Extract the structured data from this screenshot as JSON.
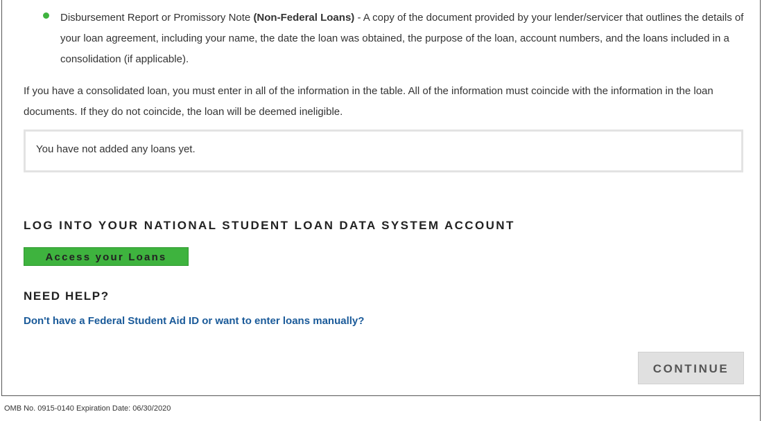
{
  "bullets": [
    {
      "lead": "Disbursement Report or Promissory Note",
      "bold": "(Non-Federal Loans)",
      "rest": "- A copy of the document provided by your lender/servicer that outlines the details of your loan agreement, including your name, the date the loan was obtained, the purpose of the loan, account numbers, and the loans included in a consolidation (if applicable).",
      "marker_color": "#3eb33e"
    }
  ],
  "info_text": "If you have a consolidated loan, you must enter in all of the information in the table. All of the information must coincide with the information in the loan documents. If they do not coincide, the loan will be deemed ineligible.",
  "loans_table": {
    "empty_message": "You have not added any loans yet."
  },
  "nslds": {
    "heading": "LOG INTO YOUR NATIONAL STUDENT LOAN DATA SYSTEM ACCOUNT",
    "button_label": "Access your Loans",
    "button_color": "#3eb33e"
  },
  "help": {
    "heading": "NEED HELP?",
    "link_text": "Don't have a Federal Student Aid ID or want to enter loans manually?",
    "link_color": "#1a5a99"
  },
  "actions": {
    "continue_label": "CONTINUE"
  },
  "footer": {
    "omb_text": "OMB No. 0915-0140 Expiration Date: 06/30/2020"
  }
}
